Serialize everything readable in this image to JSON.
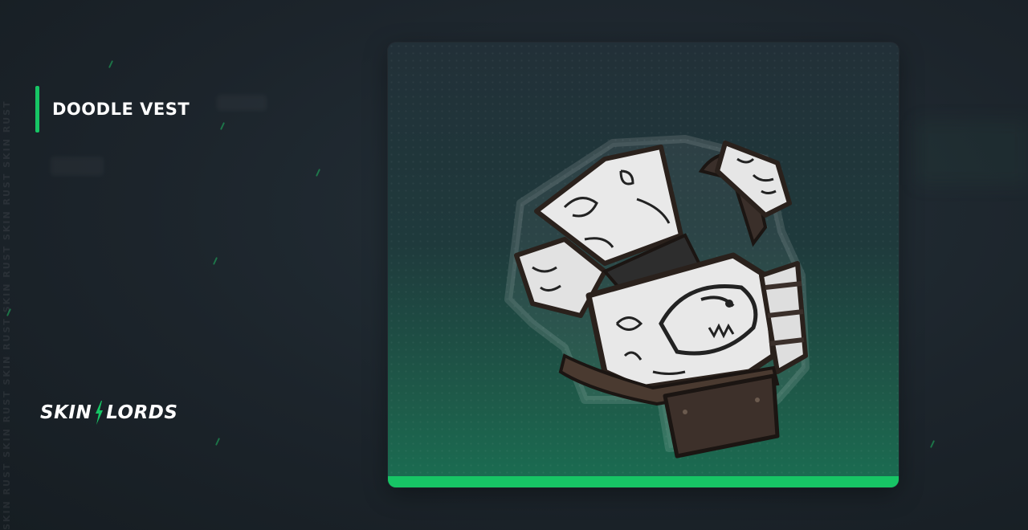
{
  "item": {
    "name": "DOODLE VEST",
    "image_icon": "doodle-vest-armor-icon"
  },
  "brand": {
    "name_left": "SKIN",
    "name_right": "LORDS",
    "mark_icon": "lightning-bolt-icon"
  },
  "watermark": "SKIN RUST SKIN RUST SKIN RUST SKIN RUST SKIN RUST SKIN RUST",
  "colors": {
    "accent": "#17c565",
    "background": "#1c242b",
    "card_top": "#223038",
    "card_bottom": "#1a6e52"
  }
}
